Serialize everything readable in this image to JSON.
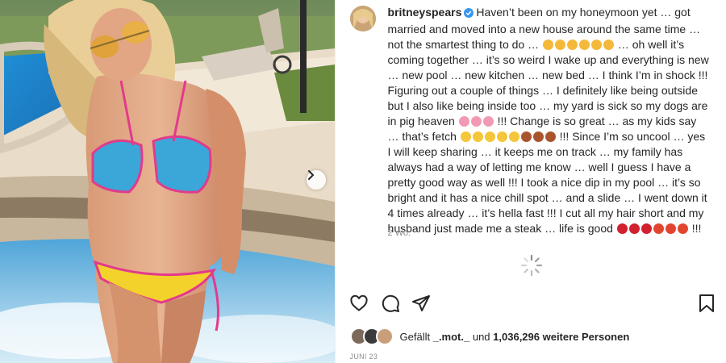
{
  "post": {
    "username": "britneyspears",
    "verified": true,
    "caption_parts": [
      "Haven’t been on my honeymoon yet … got married and moved into a new house around the same time … not the smartest thing to do … ",
      " … oh well it’s coming together … it’s so weird I wake up and everything is new … new pool … new kitchen … new bed … I think I’m in shock !!! Figuring out a couple of things … I definitely like being outside but I also like being inside too … my yard is sick so my dogs are in pig heaven ",
      " !!! Change is so great … as my kids say … that’s fetch ",
      " !!! Since I’m so uncool … yes I will keep sharing … it keeps me on track … my family has always had a way of letting me know … well I guess I have a pretty good way as well !!! I took a nice dip in my pool … it’s so bright and it has a nice chill spot … and a slide … I went down it 4 times already … it’s hella fast !!! I cut all my hair short and my husband just made me a steak … life is good ",
      " !!!"
    ],
    "emoji_groups": [
      {
        "icon": "frown-faces-emoji",
        "colors": [
          "#f5b93a",
          "#f5b93a",
          "#f5b93a",
          "#f5b93a",
          "#f5b93a",
          "#f5b93a"
        ]
      },
      {
        "icon": "pig-face-emoji",
        "colors": [
          "#f29ab3",
          "#f29ab3",
          "#f29ab3"
        ]
      },
      {
        "icon": "smiley-monkey-emoji",
        "colors": [
          "#f5c63a",
          "#f5c63a",
          "#f5c63a",
          "#f5c63a",
          "#f5c63a",
          "#a8552e",
          "#a8552e",
          "#a8552e"
        ]
      },
      {
        "icon": "lips-rose-emoji",
        "colors": [
          "#d1202f",
          "#d1202f",
          "#d1202f",
          "#e2452f",
          "#e2452f",
          "#e2452f"
        ]
      }
    ],
    "time_ago": "2 Wo.",
    "likes_prefix": "Gefällt ",
    "likes_user": "_.mot._",
    "likes_middle": " und ",
    "likes_count": "1,036,296 weitere Personen",
    "date": "JUNI 23"
  },
  "actions": {
    "like_icon": "heart-icon",
    "comment_icon": "comment-icon",
    "share_icon": "send-icon",
    "save_icon": "bookmark-icon"
  },
  "colors": {
    "verified": "#3897f0",
    "text": "#262626",
    "muted": "#8e8e8e"
  }
}
